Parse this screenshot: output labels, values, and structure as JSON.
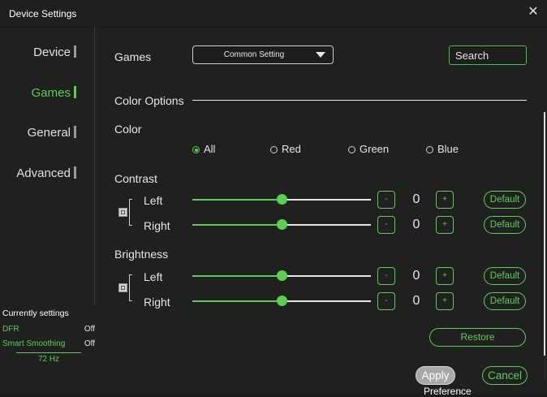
{
  "window": {
    "title": "Device Settings",
    "close_icon": "close-icon"
  },
  "sidebar": {
    "items": [
      {
        "label": "Device",
        "active": false
      },
      {
        "label": "Games",
        "active": true
      },
      {
        "label": "General",
        "active": false
      },
      {
        "label": "Advanced",
        "active": false
      }
    ]
  },
  "status": {
    "title": "Currently settings",
    "rows": [
      {
        "key": "DFR",
        "value": "Off"
      },
      {
        "key": "Smart Smoothing",
        "value": "Off"
      }
    ],
    "refresh_rate": "72 Hz"
  },
  "games": {
    "label": "Games",
    "select_value": "Common Setting",
    "search_placeholder": "Search"
  },
  "color_options": {
    "section_title": "Color Options",
    "color_label": "Color",
    "radios": [
      {
        "label": "All",
        "selected": true
      },
      {
        "label": "Red",
        "selected": false
      },
      {
        "label": "Green",
        "selected": false
      },
      {
        "label": "Blue",
        "selected": false
      }
    ]
  },
  "contrast": {
    "title": "Contrast",
    "left": {
      "label": "Left",
      "value": "0",
      "level": 0.5
    },
    "right": {
      "label": "Right",
      "value": "0",
      "level": 0.5
    }
  },
  "brightness": {
    "title": "Brightness",
    "left": {
      "label": "Left",
      "value": "0",
      "level": 0.5
    },
    "right": {
      "label": "Right",
      "value": "0",
      "level": 0.5
    }
  },
  "controls": {
    "minus": "-",
    "plus": "+",
    "default": "Default"
  },
  "buttons": {
    "restore": "Restore",
    "apply": "Apply",
    "cancel": "Cancel"
  },
  "background_fragment": "Preference",
  "colors": {
    "accent": "#5ad04f",
    "background": "#202020",
    "text": "#e6e6e6"
  }
}
